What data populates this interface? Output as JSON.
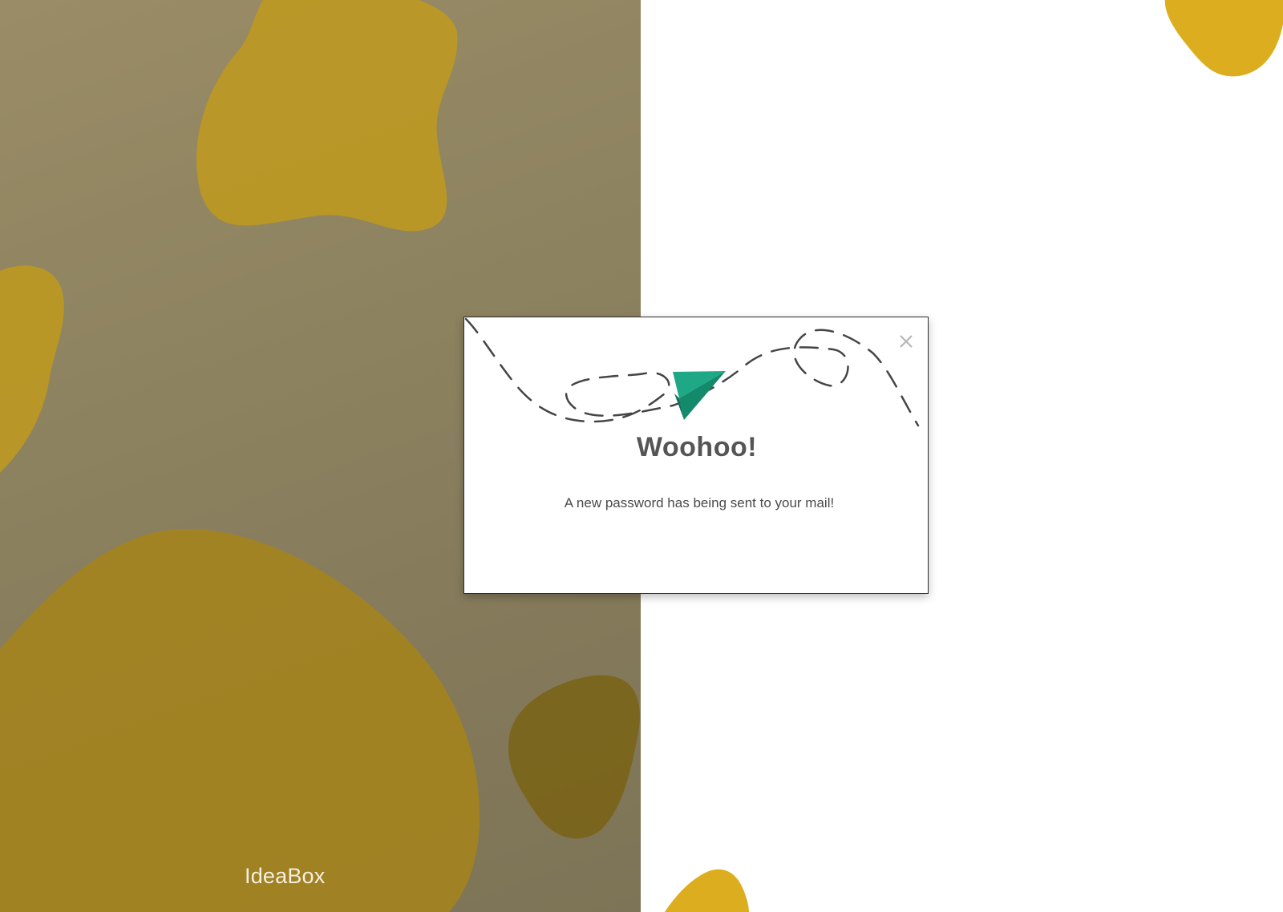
{
  "brand": {
    "name": "IdeaBox"
  },
  "modal": {
    "title": "Woohoo!",
    "message": "A new password has being sent to your mail!",
    "close_icon": "close-icon",
    "illustration_icon": "paper-plane-icon"
  },
  "colors": {
    "left_panel": "#8b815f",
    "blob": "#d7ab1e",
    "plane": "#1f9e7f",
    "title": "#555555"
  }
}
